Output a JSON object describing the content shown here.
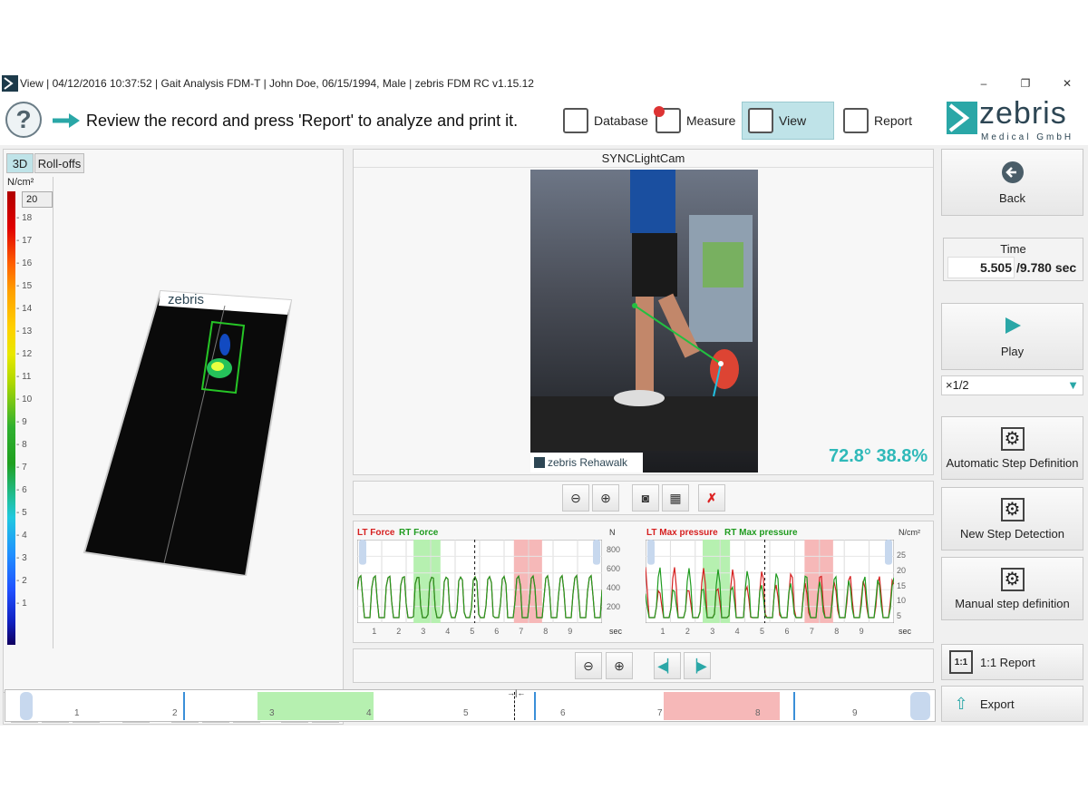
{
  "window": {
    "title": "View | 04/12/2016 10:37:52 | Gait Analysis FDM-T | John Doe, 06/15/1994, Male | zebris FDM RC v1.15.12",
    "minimize_label": "–",
    "restore_label": "❐",
    "close_label": "✕"
  },
  "toolbar": {
    "help_label": "?",
    "instruction": "Review the record and press 'Report' to analyze and print it.",
    "nav": [
      {
        "label": "Database",
        "icon": "database-icon"
      },
      {
        "label": "Measure",
        "icon": "measure-icon"
      },
      {
        "label": "View",
        "icon": "view-icon",
        "active": true
      },
      {
        "label": "Report",
        "icon": "report-icon"
      }
    ],
    "brand": {
      "name": "zebris",
      "sub": "Medical GmbH"
    }
  },
  "left_panel": {
    "tabs": [
      {
        "label": "3D",
        "active": true
      },
      {
        "label": "Roll-offs"
      }
    ],
    "unit": "N/cm²",
    "max_value": "20",
    "scale_ticks": [
      "18",
      "17",
      "16",
      "15",
      "14",
      "13",
      "12",
      "11",
      "10",
      "9",
      "8",
      "7",
      "6",
      "5",
      "4",
      "3",
      "2",
      "1"
    ],
    "plate_brand": "zebris"
  },
  "video_panel": {
    "title": "SYNCLightCam",
    "angle_readout": "72.8° 38.8%",
    "overlay_brand": "zebris Rehawalk"
  },
  "force_chart": {
    "lt_label": "LT Force",
    "rt_label": "RT Force",
    "unit": "N",
    "y_ticks": [
      "800",
      "600",
      "400",
      "200"
    ],
    "x_ticks": [
      "1",
      "2",
      "3",
      "4",
      "5",
      "6",
      "7",
      "8",
      "9"
    ],
    "x_unit": "sec"
  },
  "pressure_chart": {
    "lt_label": "LT Max pressure",
    "rt_label": "RT Max pressure",
    "unit": "N/cm²",
    "y_ticks": [
      "25",
      "20",
      "15",
      "10",
      "5"
    ],
    "x_ticks": [
      "1",
      "2",
      "3",
      "4",
      "5",
      "6",
      "7",
      "8",
      "9"
    ],
    "x_unit": "sec"
  },
  "right_panel": {
    "back_label": "Back",
    "time_label": "Time",
    "time_current": "5.505",
    "time_total": "/9.780 sec",
    "play_label": "Play",
    "speed": "×1/2",
    "auto_step": "Automatic Step Definition",
    "new_step": "New Step Detection",
    "manual_step": "Manual step definition",
    "report_11": "1:1 Report",
    "export": "Export"
  },
  "timeline": {
    "ticks": [
      "1",
      "2",
      "3",
      "4",
      "5",
      "6",
      "7",
      "8",
      "9"
    ]
  },
  "colors": {
    "accent": "#2aa7a7",
    "lt": "#d62020",
    "rt": "#1f9b1f",
    "green_band": "#b6f0b0",
    "red_band": "#f6b8b8",
    "active_nav": "#bfe3e8"
  }
}
